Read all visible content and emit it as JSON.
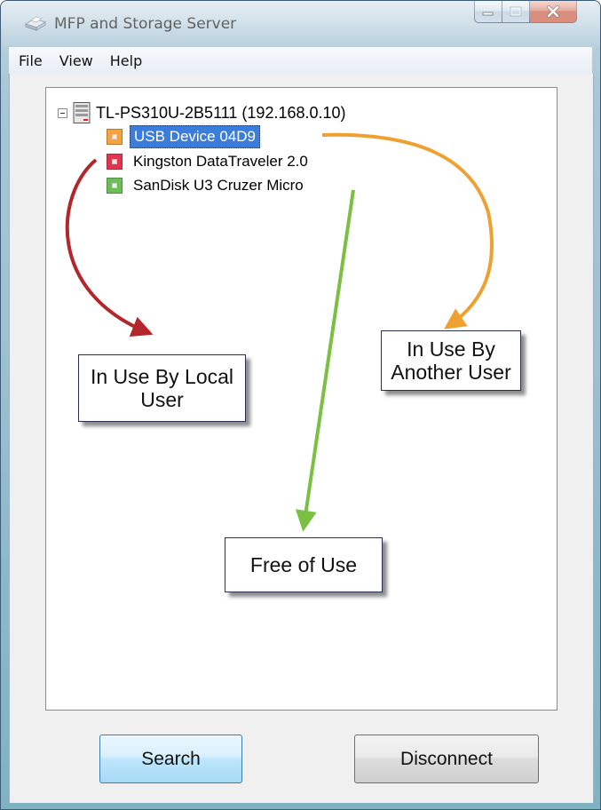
{
  "window": {
    "title": "MFP and Storage Server",
    "accent_color": "#3b7ddb"
  },
  "menu": [
    "File",
    "View",
    "Help"
  ],
  "tree": {
    "root": {
      "label": "TL-PS310U-2B5111 (192.168.0.10)",
      "icon": "server-icon",
      "expanded": true
    },
    "items": [
      {
        "label": "USB Device 04D9",
        "status_color": "#f4a33f",
        "selected": true
      },
      {
        "label": "Kingston  DataTraveler 2.0",
        "status_color": "#e2344f",
        "selected": false
      },
      {
        "label": "SanDisk  U3 Cruzer Micro",
        "status_color": "#6cbf56",
        "selected": false
      }
    ]
  },
  "annotations": [
    {
      "text_lines": [
        "In Use By Local",
        "User"
      ],
      "arrow_color": "#b3262a"
    },
    {
      "text_lines": [
        "In Use By",
        "Another User"
      ],
      "arrow_color": "#f0a030"
    },
    {
      "text_lines": [
        "Free of Use"
      ],
      "arrow_color": "#7bc043"
    }
  ],
  "buttons": {
    "search": "Search",
    "disconnect": "Disconnect"
  }
}
